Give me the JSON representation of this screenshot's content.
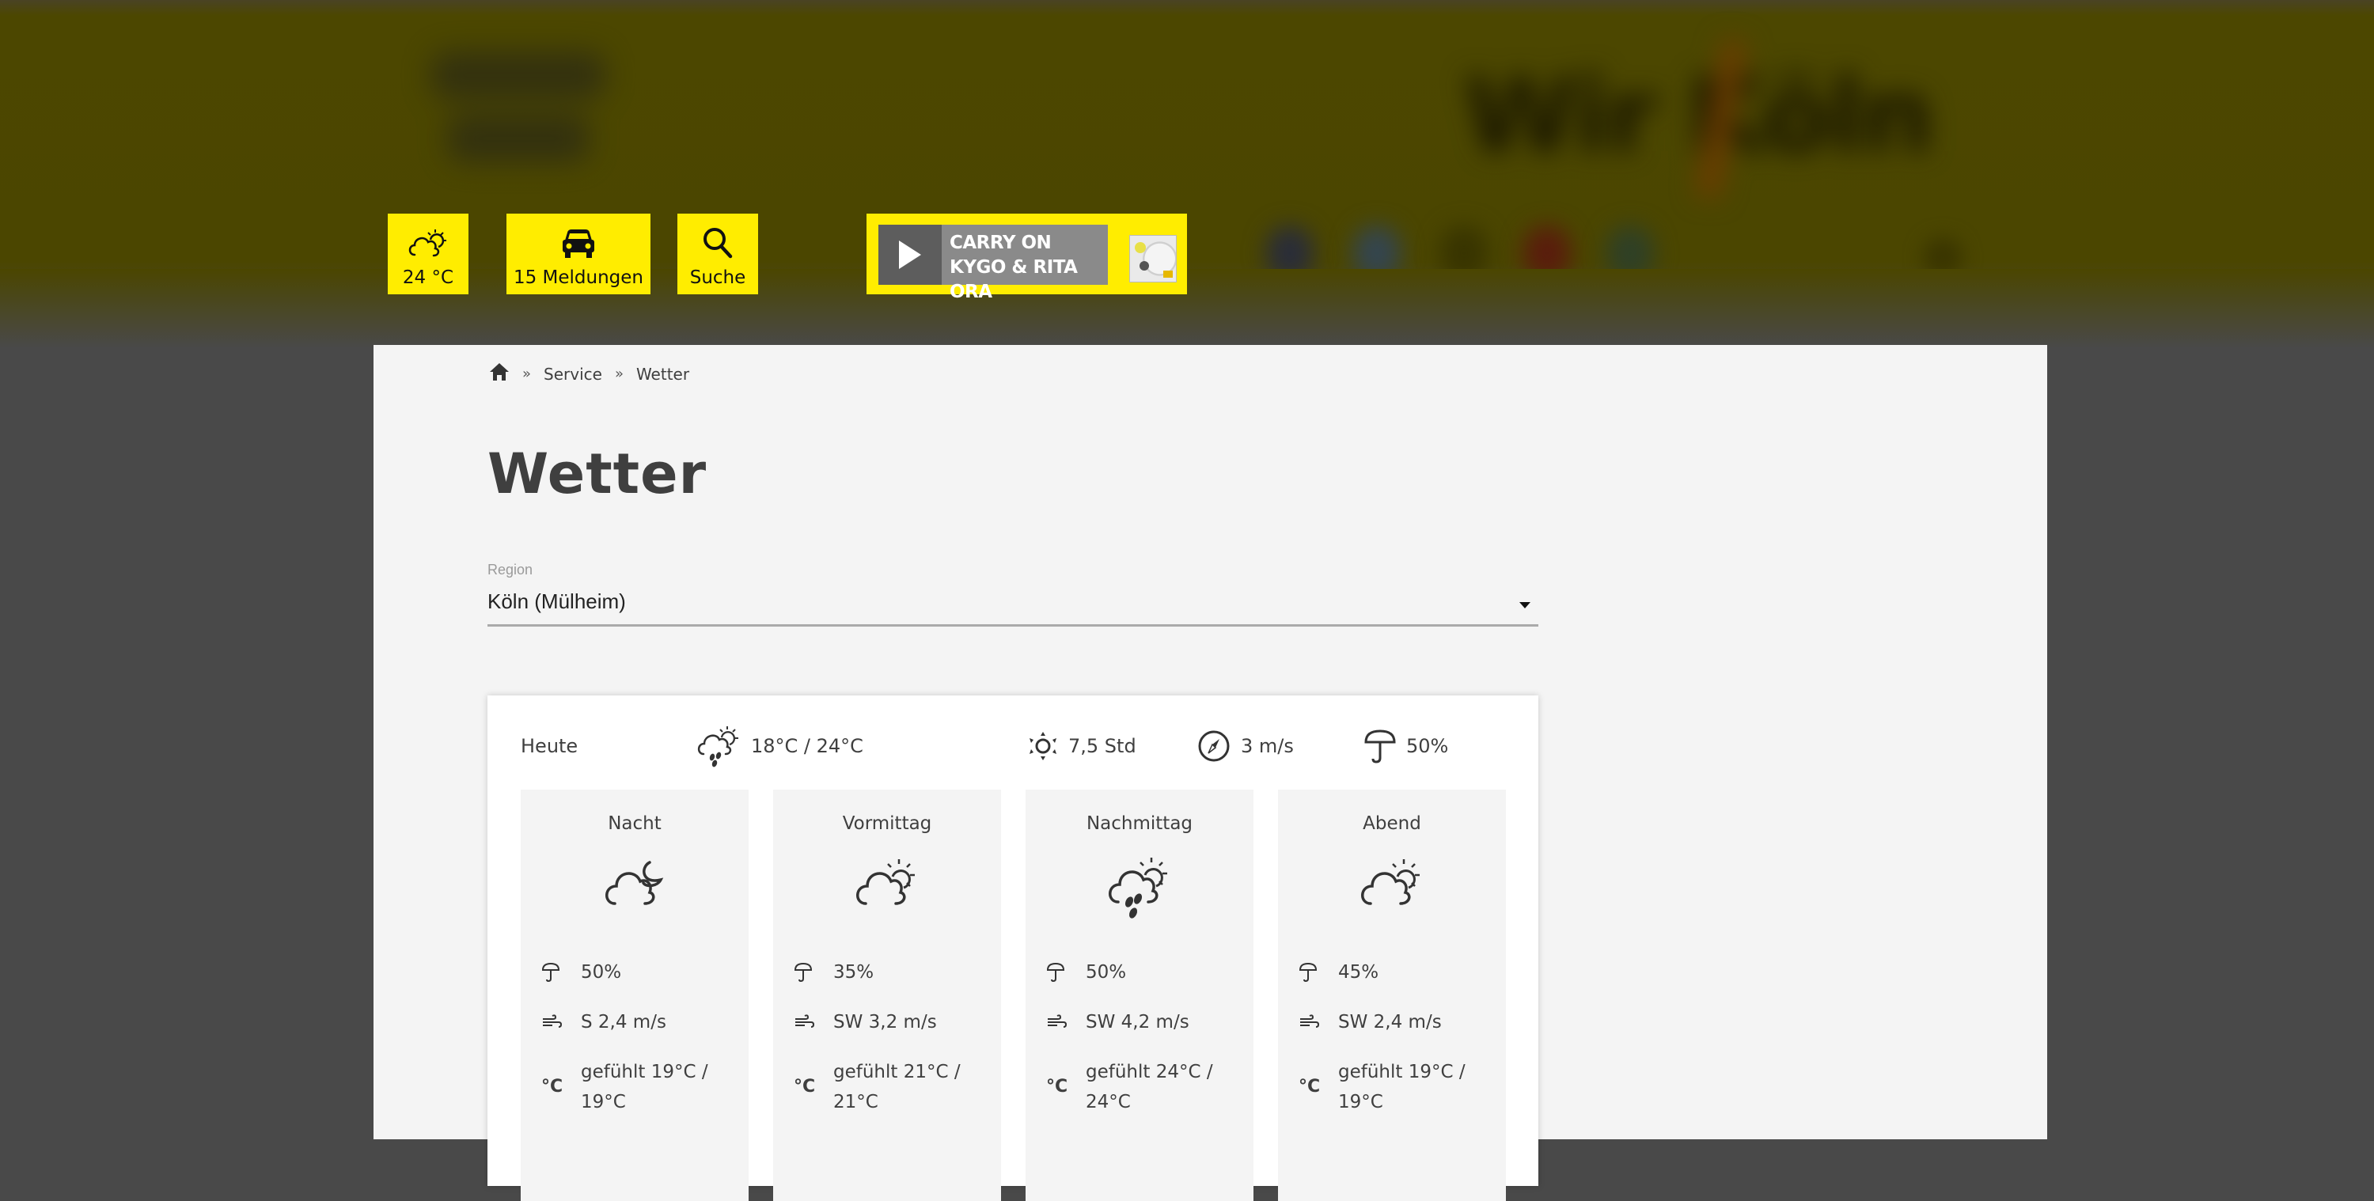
{
  "header": {
    "brand_logo_alt": "Wir. Köln",
    "quick_buttons": [
      {
        "icon": "partly-cloudy-icon",
        "label": "24 °C"
      },
      {
        "icon": "car-icon",
        "label": "15 Meldungen"
      },
      {
        "icon": "search-icon",
        "label": "Suche"
      }
    ],
    "player": {
      "song_title": "CARRY ON",
      "artist": "KYGO & RITA ORA",
      "play_icon": "play-icon"
    },
    "social_icons": [
      "facebook-icon",
      "twitter-icon",
      "instagram-icon",
      "youtube-icon",
      "whatsapp-icon"
    ],
    "accent_color": "#ffed00"
  },
  "breadcrumb": {
    "home_icon": "home-icon",
    "separator": "»",
    "items": [
      "Service",
      "Wetter"
    ]
  },
  "page": {
    "title": "Wetter"
  },
  "region": {
    "label": "Region",
    "selected": "Köln (Mülheim)"
  },
  "today": {
    "label": "Heute",
    "temp_range": "18°C / 24°C",
    "sunshine": "7,5 Std",
    "wind": "3 m/s",
    "rain_probability": "50%",
    "periods": [
      {
        "name": "Nacht",
        "icon": "cloud-moon-icon",
        "rain": "50%",
        "wind": "S 2,4 m/s",
        "feels_like": "gefühlt 19°C / 19°C"
      },
      {
        "name": "Vormittag",
        "icon": "cloud-sun-icon",
        "rain": "35%",
        "wind": "SW 3,2 m/s",
        "feels_like": "gefühlt 21°C / 21°C"
      },
      {
        "name": "Nachmittag",
        "icon": "cloud-sun-rain-icon",
        "rain": "50%",
        "wind": "SW 4,2 m/s",
        "feels_like": "gefühlt 24°C / 24°C"
      },
      {
        "name": "Abend",
        "icon": "cloud-sun-icon",
        "rain": "45%",
        "wind": "SW 2,4 m/s",
        "feels_like": "gefühlt 19°C / 19°C"
      }
    ]
  }
}
